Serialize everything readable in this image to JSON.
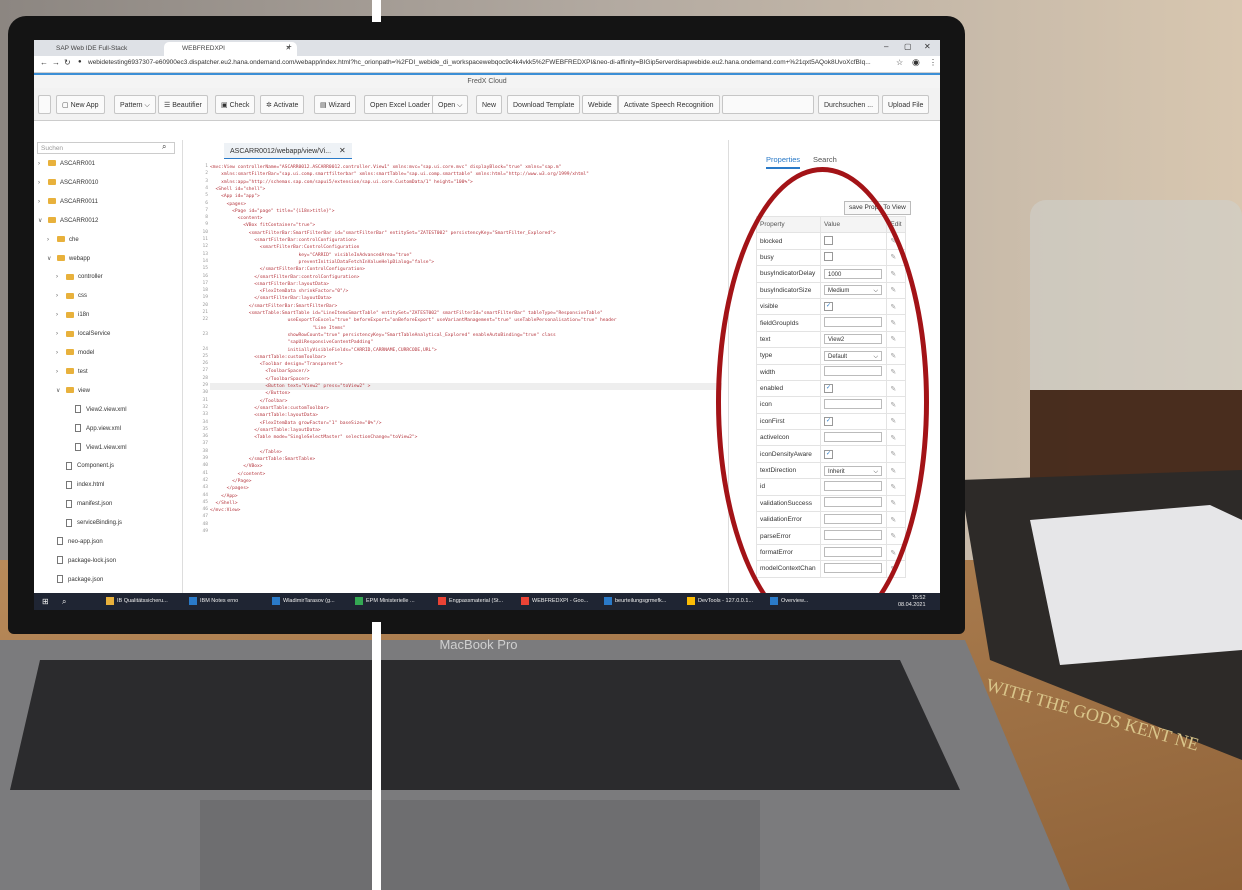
{
  "browser": {
    "tabs": [
      {
        "label": "SAP Web IDE Full-Stack"
      },
      {
        "label": "WEBFREDXPI"
      }
    ],
    "url": "webidetesting6937307-e60900ec3.dispatcher.eu2.hana.ondemand.com/webapp/index.html?hc_orionpath=%2FDI_webide_di_workspacewebqoc9c4k4vkk5%2FWEBFREDXPI&neo-di-affinity=BIGip5erverdisapwebide.eu2.hana.ondemand.com+%21qxt5AQok8UvoXcfBIq...",
    "new_tab_symbol": "+",
    "window_controls": [
      "–",
      "▢",
      "✕"
    ]
  },
  "app": {
    "title": "FredX Cloud"
  },
  "toolbar": {
    "buttons": [
      "New App",
      "Pattern",
      "Beautifier",
      "Check",
      "Activate",
      "Wizard",
      "Open Excel Loader",
      "Open",
      "New",
      "Download Template",
      "Webide",
      "Activate Speech Recognition"
    ],
    "browse_label": "Durchsuchen ...",
    "upload_label": "Upload File"
  },
  "sidebar": {
    "search_placeholder": "Suchen",
    "items": [
      {
        "label": "ASCARR001",
        "kind": "folder",
        "chev": ">",
        "indent": 0
      },
      {
        "label": "ASCARR0010",
        "kind": "folder",
        "chev": ">",
        "indent": 0
      },
      {
        "label": "ASCARR0011",
        "kind": "folder",
        "chev": ">",
        "indent": 0
      },
      {
        "label": "ASCARR0012",
        "kind": "folder",
        "chev": "v",
        "indent": 0
      },
      {
        "label": "che",
        "kind": "folder",
        "chev": ">",
        "indent": 1
      },
      {
        "label": "webapp",
        "kind": "folder",
        "chev": "v",
        "indent": 1
      },
      {
        "label": "controller",
        "kind": "folder",
        "chev": ">",
        "indent": 2
      },
      {
        "label": "css",
        "kind": "folder",
        "chev": ">",
        "indent": 2
      },
      {
        "label": "i18n",
        "kind": "folder",
        "chev": ">",
        "indent": 2
      },
      {
        "label": "localService",
        "kind": "folder",
        "chev": ">",
        "indent": 2
      },
      {
        "label": "model",
        "kind": "folder",
        "chev": ">",
        "indent": 2
      },
      {
        "label": "test",
        "kind": "folder",
        "chev": ">",
        "indent": 2
      },
      {
        "label": "view",
        "kind": "folder",
        "chev": "v",
        "indent": 2
      },
      {
        "label": "View2.view.xml",
        "kind": "file",
        "chev": "",
        "indent": 3
      },
      {
        "label": "App.view.xml",
        "kind": "file",
        "chev": "",
        "indent": 3
      },
      {
        "label": "View1.view.xml",
        "kind": "file",
        "chev": "",
        "indent": 3
      },
      {
        "label": "Component.js",
        "kind": "file",
        "chev": "",
        "indent": 2
      },
      {
        "label": "index.html",
        "kind": "file",
        "chev": "",
        "indent": 2
      },
      {
        "label": "manifest.json",
        "kind": "file",
        "chev": "",
        "indent": 2
      },
      {
        "label": "serviceBinding.js",
        "kind": "file",
        "chev": "",
        "indent": 2
      },
      {
        "label": "neo-app.json",
        "kind": "file",
        "chev": "",
        "indent": 1
      },
      {
        "label": "package-lock.json",
        "kind": "file",
        "chev": "",
        "indent": 1
      },
      {
        "label": "package.json",
        "kind": "file",
        "chev": "",
        "indent": 1
      },
      {
        "label": "ui5.yaml",
        "kind": "file",
        "chev": "",
        "indent": 1
      }
    ]
  },
  "editor": {
    "tab_label": "ASCARR0012/webapp/view/Vi...",
    "tab_close": "✕",
    "lines": [
      {
        "n": "1",
        "t": "<mvc:View controllerName=\"ASCARR0012.ASCARR0012.controller.View1\" xmlns:mvc=\"sap.ui.core.mvc\" displayBlock=\"true\" xmlns=\"sap.m\""
      },
      {
        "n": "2",
        "t": "    xmlns:smartFilterBar=\"sap.ui.comp.smartfilterbar\" xmlns:smartTable=\"sap.ui.comp.smarttable\" xmlns:html=\"http://www.w3.org/1999/xhtml\""
      },
      {
        "n": "3",
        "t": "    xmlns:app=\"http://schemas.sap.com/sapui5/extension/sap.ui.core.CustomData/1\" height=\"100%\">"
      },
      {
        "n": "4",
        "t": "  <Shell id=\"shell\">"
      },
      {
        "n": "5",
        "t": "    <App id=\"app\">"
      },
      {
        "n": "6",
        "t": "      <pages>"
      },
      {
        "n": "7",
        "t": "        <Page id=\"page\" title=\"{i18n>title}\">"
      },
      {
        "n": "8",
        "t": "          <content>"
      },
      {
        "n": "9",
        "t": "            <VBox fitContainer=\"true\">"
      },
      {
        "n": "10",
        "t": "              <smartFilterBar:SmartFilterBar id=\"smartFilterBar\" entitySet=\"ZATEST002\" persistencyKey=\"SmartFilter_Explored\">"
      },
      {
        "n": "11",
        "t": "                <smartFilterBar:controlConfiguration>"
      },
      {
        "n": "12",
        "t": "                  <smartFilterBar:ControlConfiguration"
      },
      {
        "n": "13",
        "t": "                                key=\"CARRID\" visibleInAdvancedArea=\"true\""
      },
      {
        "n": "14",
        "t": "                                preventInitialDataFetchInValueHelpDialog=\"false\">"
      },
      {
        "n": "15",
        "t": "                  </smartFilterBar:ControlConfiguration>"
      },
      {
        "n": "16",
        "t": "                </smartFilterBar:controlConfiguration>"
      },
      {
        "n": "17",
        "t": "                <smartFilterBar:layoutData>"
      },
      {
        "n": "18",
        "t": "                  <FlexItemData shrinkFactor=\"0\"/>"
      },
      {
        "n": "19",
        "t": "                </smartFilterBar:layoutData>"
      },
      {
        "n": "20",
        "t": "              </smartFilterBar:SmartFilterBar>"
      },
      {
        "n": "21",
        "t": "              <smartTable:SmartTable id=\"LineItemsSmartTable\" entitySet=\"ZATEST002\" smartFilterId=\"smartFilterBar\" tableType=\"ResponsiveTable\""
      },
      {
        "n": "22",
        "t": "                            useExportToExcel=\"true\" beforeExport=\"onBeforeExport\" useVariantManagement=\"true\" useTablePersonalisation=\"true\" header"
      },
      {
        "n": "",
        "t": "                                     \"Line Items\""
      },
      {
        "n": "23",
        "t": "                            showRowCount=\"true\" persistencyKey=\"SmartTableAnalytical_Explored\" enableAutoBinding=\"true\" class"
      },
      {
        "n": "",
        "t": "                            \"sapUiResponsiveContentPadding\""
      },
      {
        "n": "24",
        "t": "                            initiallyVisibleFields=\"CARRID,CARRNAME,CURRCODE,URL\">"
      },
      {
        "n": "25",
        "t": "                <smartTable:customToolbar>"
      },
      {
        "n": "26",
        "t": "                  <Toolbar design=\"Transparent\">"
      },
      {
        "n": "27",
        "t": "                    <ToolbarSpacer/>"
      },
      {
        "n": "28",
        "t": "                    </ToolbarSpacer>"
      },
      {
        "n": "29",
        "t": "                    <Button text=\"View2\" press=\"toView2\" >"
      },
      {
        "n": "30",
        "t": "                    </Button>"
      },
      {
        "n": "31",
        "t": "                  </Toolbar>"
      },
      {
        "n": "32",
        "t": "                </smartTable:customToolbar>"
      },
      {
        "n": "33",
        "t": "                <smartTable:layoutData>"
      },
      {
        "n": "34",
        "t": "                  <FlexItemData growFactor=\"1\" baseSize=\"0%\"/>"
      },
      {
        "n": "35",
        "t": "                </smartTable:layoutData>"
      },
      {
        "n": "36",
        "t": "                <Table mode=\"SingleSelectMaster\" selectionChange=\"toView2\">"
      },
      {
        "n": "37",
        "t": ""
      },
      {
        "n": "38",
        "t": "                  </Table>"
      },
      {
        "n": "39",
        "t": "              </smartTable:SmartTable>"
      },
      {
        "n": "40",
        "t": "            </VBox>"
      },
      {
        "n": "41",
        "t": "          </content>"
      },
      {
        "n": "42",
        "t": "        </Page>"
      },
      {
        "n": "43",
        "t": "      </pages>"
      },
      {
        "n": "44",
        "t": "    </App>"
      },
      {
        "n": "45",
        "t": "  </Shell>"
      },
      {
        "n": "46",
        "t": "</mvc:View>"
      },
      {
        "n": "47",
        "t": ""
      },
      {
        "n": "48",
        "t": ""
      },
      {
        "n": "49",
        "t": ""
      }
    ]
  },
  "properties": {
    "tabs": [
      "Properties",
      "Search"
    ],
    "save_label": "save Props To View",
    "headers": [
      "Property",
      "Value",
      "Edit"
    ],
    "rows": [
      {
        "name": "blocked",
        "kind": "check",
        "value": "",
        "checked": false
      },
      {
        "name": "busy",
        "kind": "check",
        "value": "",
        "checked": false
      },
      {
        "name": "busyIndicatorDelay",
        "kind": "input",
        "value": "1000"
      },
      {
        "name": "busyIndicatorSize",
        "kind": "select",
        "value": "Medium"
      },
      {
        "name": "visible",
        "kind": "check",
        "value": "",
        "checked": true
      },
      {
        "name": "fieldGroupIds",
        "kind": "input",
        "value": ""
      },
      {
        "name": "text",
        "kind": "input",
        "value": "View2"
      },
      {
        "name": "type",
        "kind": "select",
        "value": "Default"
      },
      {
        "name": "width",
        "kind": "input",
        "value": ""
      },
      {
        "name": "enabled",
        "kind": "check",
        "value": "",
        "checked": true
      },
      {
        "name": "icon",
        "kind": "input",
        "value": ""
      },
      {
        "name": "iconFirst",
        "kind": "check",
        "value": "",
        "checked": true
      },
      {
        "name": "activeIcon",
        "kind": "input",
        "value": ""
      },
      {
        "name": "iconDensityAware",
        "kind": "check",
        "value": "",
        "checked": true
      },
      {
        "name": "textDirection",
        "kind": "select",
        "value": "Inherit"
      },
      {
        "name": "id",
        "kind": "input",
        "value": ""
      },
      {
        "name": "validationSuccess",
        "kind": "input",
        "value": ""
      },
      {
        "name": "validationError",
        "kind": "input",
        "value": ""
      },
      {
        "name": "parseError",
        "kind": "input",
        "value": ""
      },
      {
        "name": "formatError",
        "kind": "input",
        "value": ""
      },
      {
        "name": "modelContextChan",
        "kind": "input",
        "value": ""
      }
    ],
    "highlight_color": "#a31317"
  },
  "taskbar": {
    "items": [
      "IB Qualitätssicheru...",
      "IBM Notes erno",
      "WladimirTarasov (g...",
      "EPM Ministerielle ...",
      "Engpassmaterial (St...",
      "WEBFREDXPI - Goo...",
      "beurteilungsgrmefk...",
      "DevTools - 127.0.0.1...",
      "Overview..."
    ],
    "time": "15:52",
    "date": "08.04.2021"
  },
  "laptop": {
    "brand": "MacBook Pro"
  },
  "book": {
    "spine_text": "WITH THE GODS  KENT NE"
  }
}
